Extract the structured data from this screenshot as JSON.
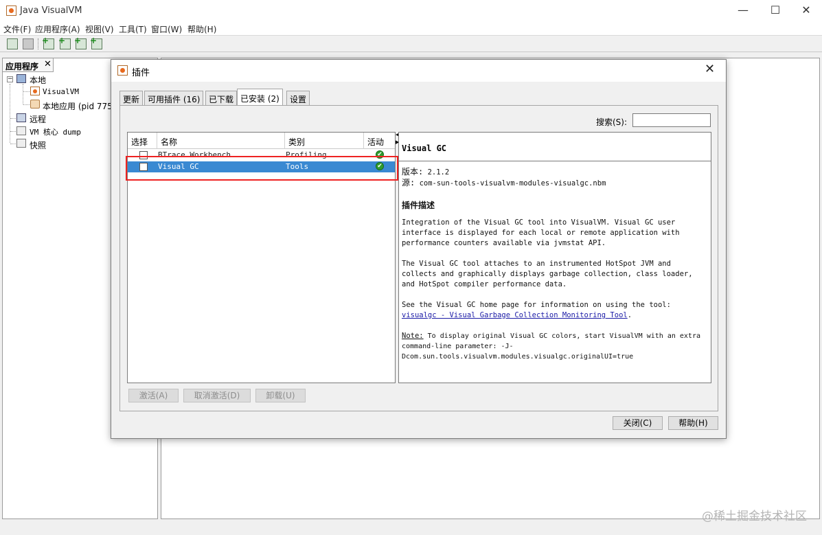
{
  "window": {
    "title": "Java VisualVM",
    "min": "—",
    "max": "☐",
    "close": "✕"
  },
  "menu": [
    "文件(F)",
    "应用程序(A)",
    "视图(V)",
    "工具(T)",
    "窗口(W)",
    "帮助(H)"
  ],
  "left_panel": {
    "tab_label": "应用程序",
    "tab_close": "✕",
    "tree": {
      "local": "本地",
      "visualvm": "VisualVM",
      "local_app": "本地应用 (pid 775",
      "remote": "远程",
      "vm_core_dump": "VM 核心 dump",
      "snapshots": "快照"
    }
  },
  "dialog": {
    "title": "插件",
    "close": "✕",
    "tabs": [
      "更新",
      "可用插件 (16)",
      "已下载",
      "已安装 (2)",
      "设置"
    ],
    "active_tab": 3,
    "search_label": "搜索(S):",
    "search_value": "",
    "table": {
      "headers": [
        "选择",
        "名称",
        "类别",
        "活动"
      ],
      "rows": [
        {
          "name": "BTrace Workbench",
          "category": "Profiling",
          "active_icon": "ok-check-icon",
          "selected": false
        },
        {
          "name": "Visual GC",
          "category": "Tools",
          "active_icon": "ok-check-icon",
          "selected": true
        }
      ]
    },
    "details": {
      "title": "Visual GC",
      "version_label": "版本:",
      "version": "2.1.2",
      "source_label": "源:",
      "source": "com-sun-tools-visualvm-modules-visualgc.nbm",
      "desc_heading": "插件描述",
      "para1": "Integration of the Visual GC tool into VisualVM. Visual GC user interface is displayed for each local or remote application with performance counters available via jvmstat API.",
      "para2": "The Visual GC tool attaches to an instrumented HotSpot JVM and collects and graphically displays garbage collection, class loader, and HotSpot compiler performance data.",
      "para3_prefix": "See the Visual GC home page for information on using the tool: ",
      "para3_link": "visualgc - Visual Garbage Collection Monitoring Tool",
      "para3_suffix": ".",
      "note_label": "Note:",
      "note_text": " To display original Visual GC colors, start VisualVM with an extra command-line parameter: -J-Dcom.sun.tools.visualvm.modules.visualgc.originalUI=true"
    },
    "buttons": {
      "activate": "激活(A)",
      "deactivate": "取消激活(D)",
      "uninstall": "卸载(U)",
      "close": "关闭(C)",
      "help": "帮助(H)"
    }
  },
  "watermark": "@稀土掘金技术社区"
}
